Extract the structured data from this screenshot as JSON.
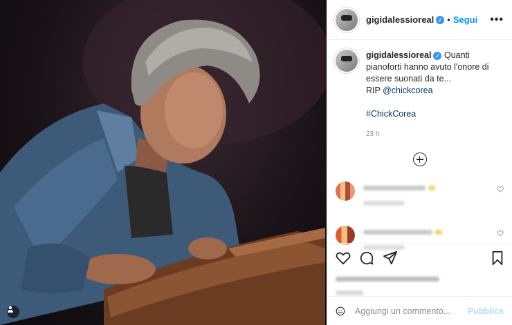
{
  "header": {
    "username": "gigidalessioreal",
    "separator": "•",
    "follow_label": "Segui",
    "more_label": "•••"
  },
  "caption": {
    "username": "gigidalessioreal",
    "text": "Quanti pianoforti hanno avuto l'onore di essere suonati da te...",
    "rip_prefix": "RIP ",
    "mention": "@chickcorea",
    "hashtag": "#ChickCorea",
    "time": "23 h"
  },
  "icons": {
    "like": "heart-icon",
    "comment": "comment-icon",
    "share": "paper-plane-icon",
    "save": "bookmark-icon",
    "load_more": "plus-circle-icon",
    "tag": "user-icon",
    "verified": "verified-icon"
  },
  "add_comment": {
    "placeholder": "Aggiungi un commento...",
    "publish_label": "Pubblica"
  },
  "colors": {
    "accent": "#0095f6",
    "verified": "#3897f0",
    "publish_disabled": "#b2dffc"
  }
}
